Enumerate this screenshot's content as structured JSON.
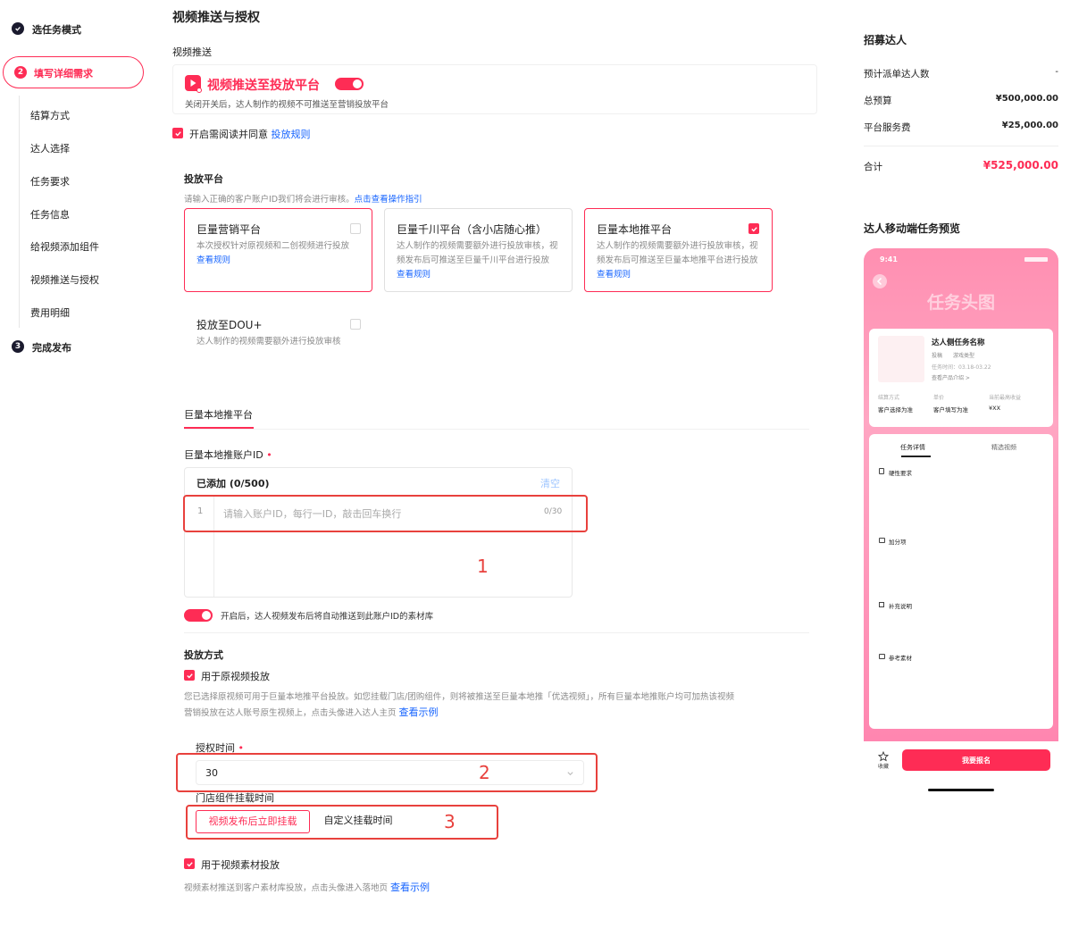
{
  "sidebar": {
    "step1": {
      "label": "选任务模式"
    },
    "step2": {
      "num": "2",
      "label": "填写详细需求"
    },
    "step3": {
      "num": "3",
      "label": "完成发布"
    },
    "items": [
      "结算方式",
      "达人选择",
      "任务要求",
      "任务信息",
      "给视频添加组件",
      "视频推送与授权",
      "费用明细"
    ]
  },
  "main": {
    "title": "视频推送与授权",
    "push_section": "视频推送",
    "push_title": "视频推送至投放平台",
    "push_hint": "关闭开关后，达人制作的视频不可推送至营销投放平台",
    "agree_text": "开启需阅读并同意",
    "agree_link": "投放规则",
    "platform_title": "投放平台",
    "platform_hint": "请输入正确的客户账户ID我们将会进行审核。",
    "platform_hint_link": "点击查看操作指引",
    "cards": [
      {
        "title": "巨量营销平台",
        "desc": "本次授权针对原视频和二创视频进行投放",
        "link": "查看规则"
      },
      {
        "title": "巨量千川平台（含小店随心推）",
        "desc": "达人制作的视频需要额外进行投放审核，视频发布后可推送至巨量千川平台进行投放",
        "link": "查看规则"
      },
      {
        "title": "巨量本地推平台",
        "desc": "达人制作的视频需要额外进行投放审核，视频发布后可推送至巨量本地推平台进行投放",
        "link": "查看规则"
      },
      {
        "title": "投放至DOU+",
        "desc": "达人制作的视频需要额外进行投放审核"
      }
    ],
    "tab_label": "巨量本地推平台",
    "account_label": "巨量本地推账户ID",
    "required_mark": "•",
    "added_label": "已添加 (0/500)",
    "clear": "清空",
    "line_no": "1",
    "account_placeholder": "请输入账户ID，每行一ID，敲击回车换行",
    "account_count": "0/30",
    "auto_push_text": "开启后，达人视频发布后将自动推送到此账户ID的素材库",
    "method_title": "投放方式",
    "orig_video_label": "用于原视频投放",
    "orig_video_desc1": "您已选择原视频可用于巨量本地推平台投放。如您挂载门店/团购组件，则将被推送至巨量本地推「优选视频」，所有巨量本地推账户均可加热该视频",
    "orig_video_desc2": "营销投放在达人账号原生视频上，点击头像进入达人主页",
    "example_link": "查看示例",
    "auth_time_label": "授权时间",
    "auth_time_value": "30",
    "store_label": "门店组件挂载时间",
    "store_opt1": "视频发布后立即挂载",
    "store_opt2": "自定义挂载时间",
    "material_label": "用于视频素材投放",
    "material_desc": "视频素材推送到客户素材库投放，点击头像进入落地页",
    "material_link": "查看示例"
  },
  "annotations": {
    "a1": "1",
    "a2": "2",
    "a3": "3"
  },
  "summary": {
    "title": "招募达人",
    "rows": [
      {
        "label": "预计派单达人数",
        "value": "-"
      },
      {
        "label": "总预算",
        "value": "¥500,000.00"
      },
      {
        "label": "平台服务费",
        "value": "¥25,000.00"
      }
    ],
    "total_label": "合计",
    "total_value": "¥525,000.00"
  },
  "preview": {
    "title": "达人移动端任务预览",
    "time": "9:41",
    "banner": "任务头图",
    "task_name": "达人侧任务名称",
    "tag1": "投稿",
    "tag2": "游戏类型",
    "date": "任务时间：03.18-03.22",
    "product_link": "查看产品介绍 >",
    "col1_label": "结算方式",
    "col1_value": "客户选择为准",
    "col2_label": "单价",
    "col2_value": "客户填写为准",
    "col3_label": "当前最高收益",
    "col3_value": "¥XX",
    "tab1": "任务详情",
    "tab2": "精选视频",
    "sec1": "硬性要求",
    "sec2": "加分项",
    "sec3": "补充说明",
    "sec4": "参考素材",
    "fav": "收藏",
    "signup": "我要报名"
  },
  "colors": {
    "accent": "#fe2c55",
    "link": "#1664ff",
    "annotation": "#e8413d"
  }
}
